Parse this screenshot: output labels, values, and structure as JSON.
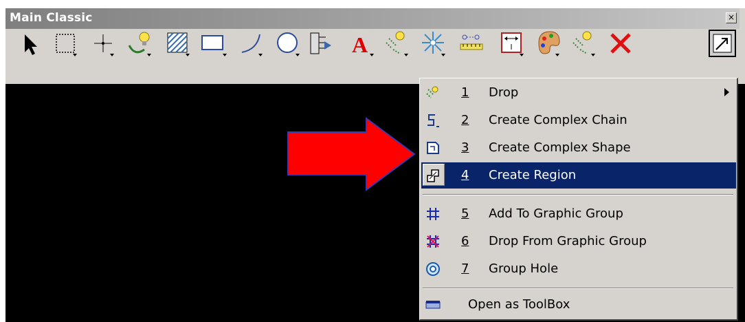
{
  "window": {
    "title": "Main Classic",
    "close_glyph": "×"
  },
  "toolbar": {
    "tools": [
      {
        "name": "select-element-icon"
      },
      {
        "name": "fence-icon"
      },
      {
        "name": "place-point-icon"
      },
      {
        "name": "group-drop-icon"
      },
      {
        "name": "pattern-area-icon"
      },
      {
        "name": "place-block-icon"
      },
      {
        "name": "place-arc-icon"
      },
      {
        "name": "place-circle-icon"
      },
      {
        "name": "place-cell-icon"
      },
      {
        "name": "place-text-icon"
      },
      {
        "name": "groups-icon"
      },
      {
        "name": "modify-element-icon"
      },
      {
        "name": "measure-distance-icon"
      },
      {
        "name": "dimension-icon"
      },
      {
        "name": "change-attributes-icon"
      },
      {
        "name": "group-tools-icon"
      },
      {
        "name": "delete-element-icon"
      },
      {
        "name": "open-toolbox-icon"
      }
    ]
  },
  "menu": {
    "items": [
      {
        "num": "1",
        "label": "Drop",
        "icon": "drop-group-icon"
      },
      {
        "num": "2",
        "label": "Create Complex Chain",
        "icon": "complex-chain-icon"
      },
      {
        "num": "3",
        "label": "Create Complex Shape",
        "icon": "complex-shape-icon"
      },
      {
        "num": "4",
        "label": "Create Region",
        "icon": "create-region-icon"
      },
      {
        "num": "5",
        "label": "Add To Graphic Group",
        "icon": "add-graphic-group-icon"
      },
      {
        "num": "6",
        "label": "Drop From Graphic Group",
        "icon": "drop-graphic-group-icon"
      },
      {
        "num": "7",
        "label": "Group Hole",
        "icon": "group-hole-icon"
      }
    ],
    "open_toolbox": {
      "label": "Open as ToolBox",
      "icon": "toolbox-icon"
    },
    "selected_index": 3
  },
  "colors": {
    "window_bg": "#d6d3ce",
    "canvas_bg": "#000000",
    "selection": "#0a246a",
    "annotation_arrow": "#ff0000"
  }
}
